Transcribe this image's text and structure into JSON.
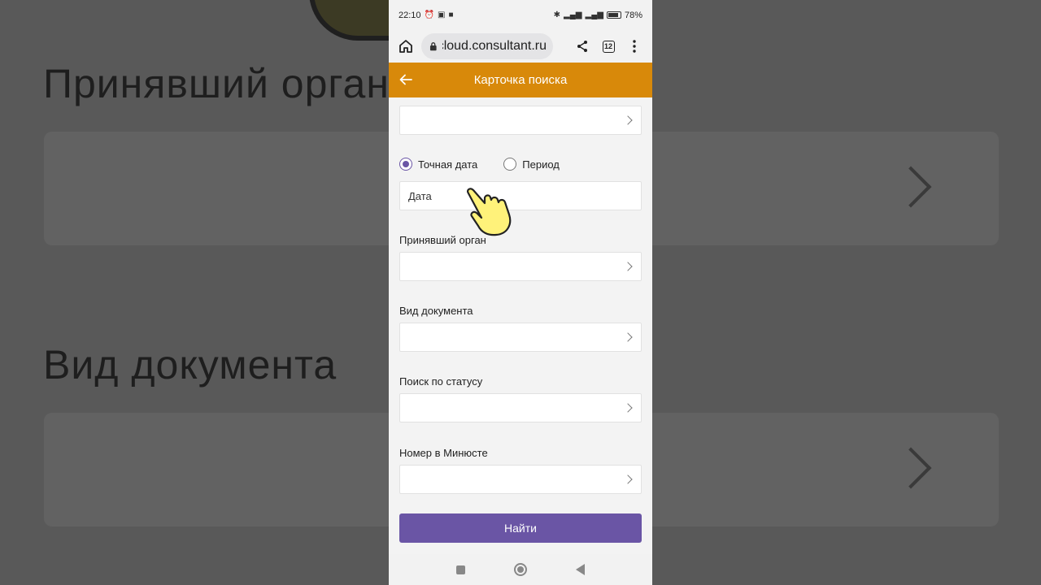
{
  "background": {
    "label_1": "Принявший орган",
    "label_2": "Вид документа"
  },
  "statusbar": {
    "time": "22:10",
    "battery": "78%"
  },
  "browser": {
    "url": "cloud.consultant.ru",
    "tab_count": "12"
  },
  "appbar": {
    "title": "Карточка поиска",
    "color": "#d8890a"
  },
  "form": {
    "date_mode": {
      "options": [
        "Точная дата",
        "Период"
      ],
      "selected": "Точная дата"
    },
    "date_placeholder": "Дата",
    "fields": [
      {
        "label": "Принявший орган",
        "value": ""
      },
      {
        "label": "Вид документа",
        "value": ""
      },
      {
        "label": "Поиск по статусу",
        "value": ""
      },
      {
        "label": "Номер в Минюсте",
        "value": ""
      }
    ],
    "submit_label": "Найти",
    "accent": "#6a55a5"
  }
}
